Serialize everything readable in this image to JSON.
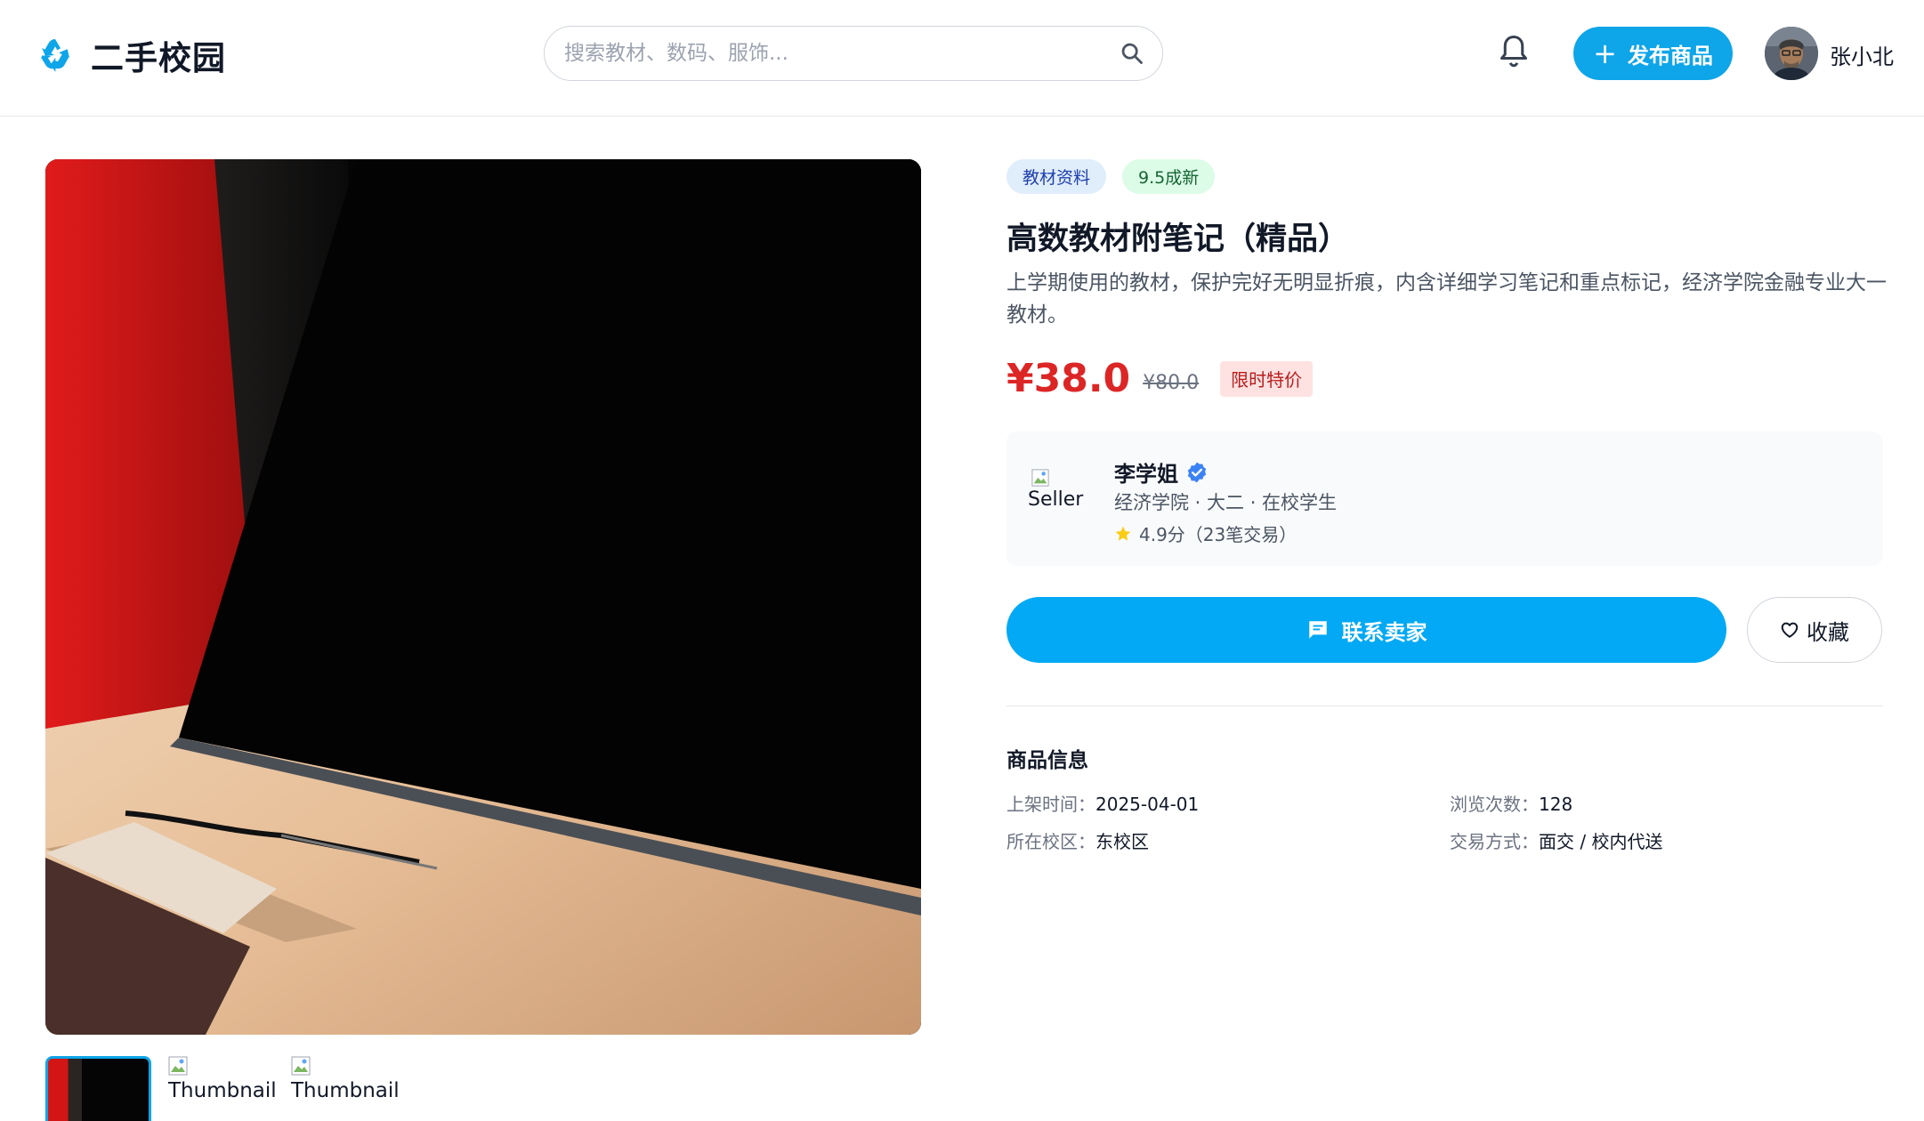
{
  "header": {
    "app_name": "二手校园",
    "logo_icon": "recycle-icon",
    "search_placeholder": "搜索教材、数码、服饰...",
    "search_icon": "search-icon",
    "notification_icon": "bell-icon",
    "publish_label": "发布商品",
    "user_name": "张小北"
  },
  "gallery": {
    "thumbnails": [
      {
        "alt": "",
        "active": true
      },
      {
        "alt": "Thumbnail",
        "active": false
      },
      {
        "alt": "Thumbnail",
        "active": false
      }
    ]
  },
  "product": {
    "tags": {
      "category": "教材资料",
      "condition": "9.5成新"
    },
    "title": "高数教材附笔记（精品）",
    "description": "上学期使用的教材，保护完好无明显折痕，内含详细学习笔记和重点标记，经济学院金融专业大一教材。",
    "price": "¥38.0",
    "original_price": "¥80.0",
    "promo_label": "限时特价"
  },
  "seller": {
    "avatar_alt": "Seller",
    "name": "李学姐",
    "details": "经济学院 · 大二 · 在校学生",
    "rating": "4.9分（23笔交易）"
  },
  "actions": {
    "contact_label": "联系卖家",
    "favorite_label": "收藏"
  },
  "info": {
    "title": "商品信息",
    "listed_key": "上架时间：",
    "listed_value": "2025-04-01",
    "views_key": "浏览次数：",
    "views_value": "128",
    "campus_key": "所在校区：",
    "campus_value": "东校区",
    "trade_key": "交易方式：",
    "trade_value": "面交 / 校内代送"
  },
  "colors": {
    "accent": "#0ea5e9",
    "contact_button": "#03a9f4",
    "price": "#dc2626"
  }
}
